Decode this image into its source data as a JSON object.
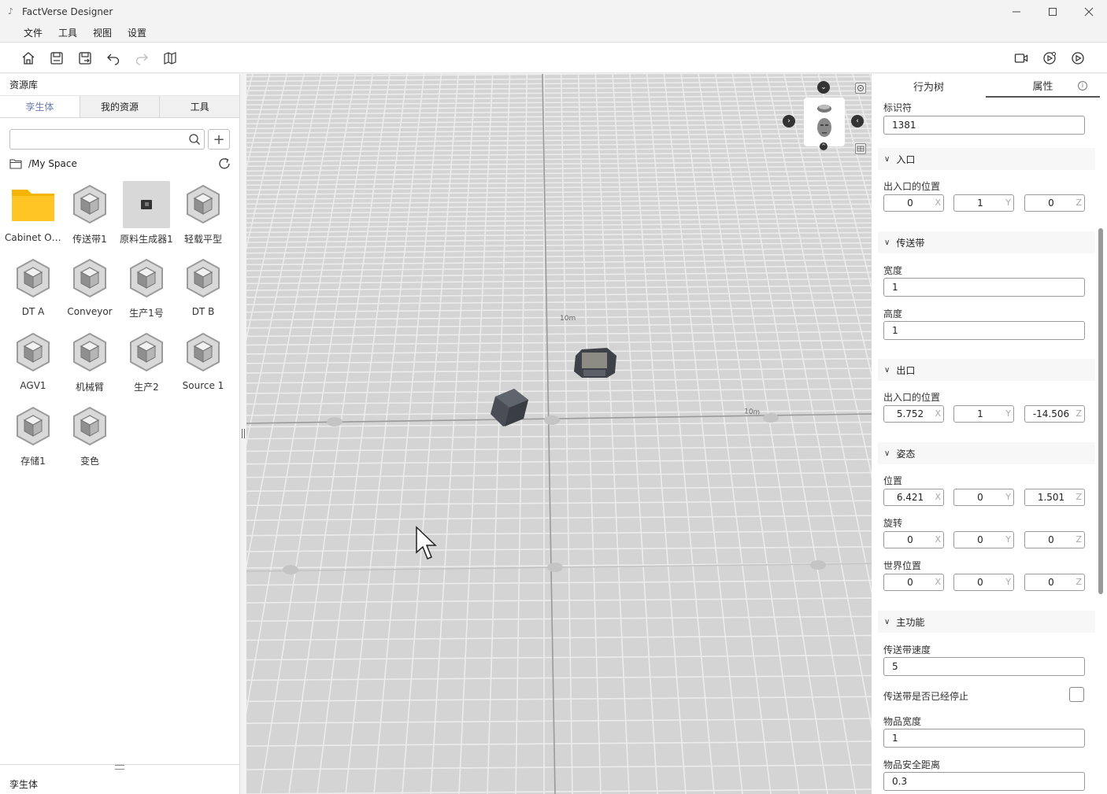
{
  "window": {
    "title": "FactVerse Designer",
    "icon": "app-logo-icon"
  },
  "menu": [
    "文件",
    "工具",
    "视图",
    "设置"
  ],
  "left_panel": {
    "header": "资源库",
    "tabs": [
      "孪生体",
      "我的资源",
      "工具"
    ],
    "search": {
      "value": "",
      "placeholder": ""
    },
    "path": "/My Space",
    "assets": [
      {
        "label": "Cabinet Op…",
        "icon": "folder-icon"
      },
      {
        "label": "传送带1",
        "icon": "cube-icon"
      },
      {
        "label": "原料生成器1",
        "icon": "generator-thumbnail",
        "selected": true
      },
      {
        "label": "轻载平型",
        "icon": "cube-icon"
      },
      {
        "label": "DT A",
        "icon": "cube-icon"
      },
      {
        "label": "Conveyor",
        "icon": "cube-icon"
      },
      {
        "label": "生产1号",
        "icon": "cube-icon"
      },
      {
        "label": "DT B",
        "icon": "cube-icon"
      },
      {
        "label": "AGV1",
        "icon": "cube-icon"
      },
      {
        "label": "机械臂",
        "icon": "cube-icon"
      },
      {
        "label": "生产2",
        "icon": "cube-icon"
      },
      {
        "label": "Source 1",
        "icon": "cube-icon"
      },
      {
        "label": "存储1",
        "icon": "cube-icon"
      },
      {
        "label": "变色",
        "icon": "cube-icon"
      }
    ],
    "footer": "孪生体"
  },
  "viewport": {
    "labels": [
      "10m",
      "10m"
    ],
    "colors": {
      "floor": "#d4d4d4",
      "grid": "#ececec",
      "axis": "#9a9a9a"
    }
  },
  "right_panel": {
    "tabs": [
      "行为树",
      "属性"
    ],
    "identifier": {
      "label": "标识符",
      "value": "1381"
    },
    "entrance": {
      "title": "入口",
      "pos_label": "出入口的位置",
      "x": "0",
      "y": "1",
      "z": "0"
    },
    "conveyor": {
      "title": "传送带",
      "width_label": "宽度",
      "width": "1",
      "height_label": "高度",
      "height": "1"
    },
    "exit": {
      "title": "出口",
      "pos_label": "出入口的位置",
      "x": "5.752",
      "y": "1",
      "z": "-14.506"
    },
    "pose": {
      "title": "姿态",
      "position_label": "位置",
      "px": "6.421",
      "py": "0",
      "pz": "1.501",
      "rotation_label": "旋转",
      "rx": "0",
      "ry": "0",
      "rz": "0",
      "world_label": "世界位置",
      "wx": "0",
      "wy": "0",
      "wz": "0"
    },
    "main": {
      "title": "主功能",
      "speed_label": "传送带速度",
      "speed": "5",
      "stopped_label": "传送带是否已经停止",
      "stopped": false,
      "item_width_label": "物品宽度",
      "item_width": "1",
      "safe_dist_label": "物品安全距离",
      "safe_dist": "0.3"
    },
    "axis_labels": {
      "x": "X",
      "y": "Y",
      "z": "Z"
    }
  }
}
